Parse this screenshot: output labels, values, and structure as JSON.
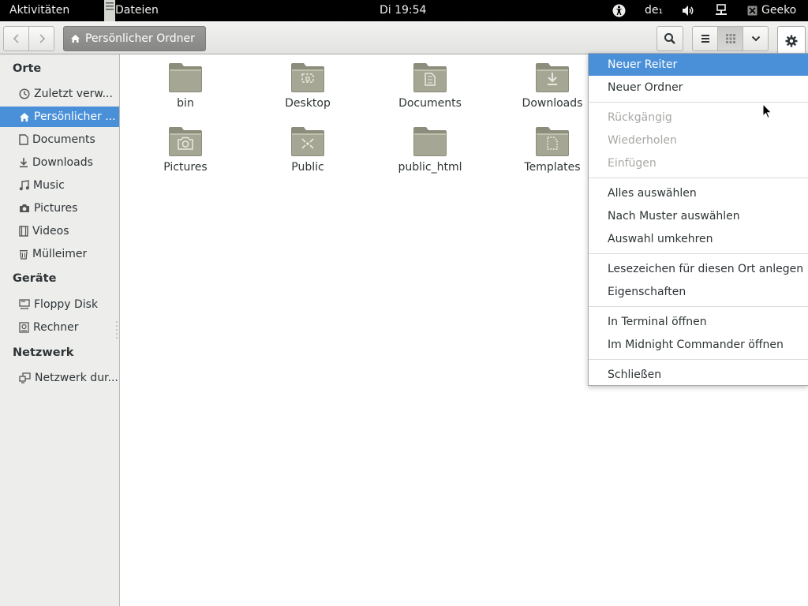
{
  "topbar": {
    "activities": "Aktivitäten",
    "app_name": "Dateien",
    "clock": "Di 19:54",
    "keyboard_layout": "de₁",
    "user": "Geeko"
  },
  "header": {
    "location": "Persönlicher Ordner"
  },
  "sidebar": {
    "places_heading": "Orte",
    "places": [
      {
        "label": "Zuletzt verw...",
        "icon": "recent-icon"
      },
      {
        "label": "Persönlicher ...",
        "icon": "home-icon",
        "active": true
      },
      {
        "label": "Documents",
        "icon": "documents-icon"
      },
      {
        "label": "Downloads",
        "icon": "downloads-icon"
      },
      {
        "label": "Music",
        "icon": "music-icon"
      },
      {
        "label": "Pictures",
        "icon": "camera-icon"
      },
      {
        "label": "Videos",
        "icon": "film-icon"
      },
      {
        "label": "Mülleimer",
        "icon": "trash-icon"
      }
    ],
    "devices_heading": "Geräte",
    "devices": [
      {
        "label": "Floppy Disk",
        "icon": "floppy-icon"
      },
      {
        "label": "Rechner",
        "icon": "computer-icon"
      }
    ],
    "network_heading": "Netzwerk",
    "network": [
      {
        "label": "Netzwerk dur...",
        "icon": "network-icon"
      }
    ]
  },
  "files": [
    {
      "name": "bin",
      "emblem": "none"
    },
    {
      "name": "Desktop",
      "emblem": "desktop"
    },
    {
      "name": "Documents",
      "emblem": "documents"
    },
    {
      "name": "Downloads",
      "emblem": "downloads"
    },
    {
      "name": "Pictures",
      "emblem": "camera"
    },
    {
      "name": "Public",
      "emblem": "share"
    },
    {
      "name": "public_html",
      "emblem": "none"
    },
    {
      "name": "Templates",
      "emblem": "templates"
    }
  ],
  "menu": {
    "items": [
      {
        "label": "Neuer Reiter",
        "state": "selected"
      },
      {
        "label": "Neuer Ordner",
        "state": "normal"
      },
      {
        "label": "Rückgängig",
        "state": "disabled"
      },
      {
        "label": "Wiederholen",
        "state": "disabled"
      },
      {
        "label": "Einfügen",
        "state": "disabled"
      },
      {
        "label": "Alles auswählen",
        "state": "normal"
      },
      {
        "label": "Nach Muster auswählen",
        "state": "normal"
      },
      {
        "label": "Auswahl umkehren",
        "state": "normal"
      },
      {
        "label": "Lesezeichen für diesen Ort anlegen",
        "state": "normal"
      },
      {
        "label": "Eigenschaften",
        "state": "normal"
      },
      {
        "label": "In Terminal öffnen",
        "state": "normal"
      },
      {
        "label": "Im Midnight Commander öffnen",
        "state": "normal"
      },
      {
        "label": "Schließen",
        "state": "normal"
      }
    ]
  },
  "colors": {
    "accent": "#4a90d9",
    "folder": "#a6a694"
  }
}
